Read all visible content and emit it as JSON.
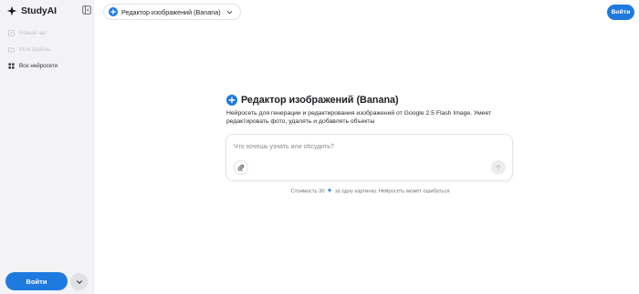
{
  "app": {
    "name": "StudyAI"
  },
  "sidebar": {
    "items": [
      {
        "label": "Новый чат",
        "icon": "edit-icon",
        "state": "disabled"
      },
      {
        "label": "Мои файлы",
        "icon": "folder-icon",
        "state": "disabled"
      },
      {
        "label": "Все нейросети",
        "icon": "grid-icon",
        "state": "active"
      }
    ],
    "login_label": "Войти"
  },
  "header": {
    "model_name": "Редактор изображений (Banana)",
    "login_label": "Войти"
  },
  "main": {
    "title": "Редактор изображений (Banana)",
    "description": "Нейросеть для генерации и редактирования изображений от Google 2.5 Flash Image. Умеет редактировать фото, удалять и добавлять объекты",
    "prompt_placeholder": "Что хочешь узнать или обсудить?",
    "cost_prefix": "Стоимость 30",
    "cost_suffix": "за одну картинку. Нейросеть может ошибаться"
  },
  "colors": {
    "accent": "#1f7ae0",
    "sidebar_bg": "#f3f3f5",
    "text_muted": "#c4c4c9"
  }
}
